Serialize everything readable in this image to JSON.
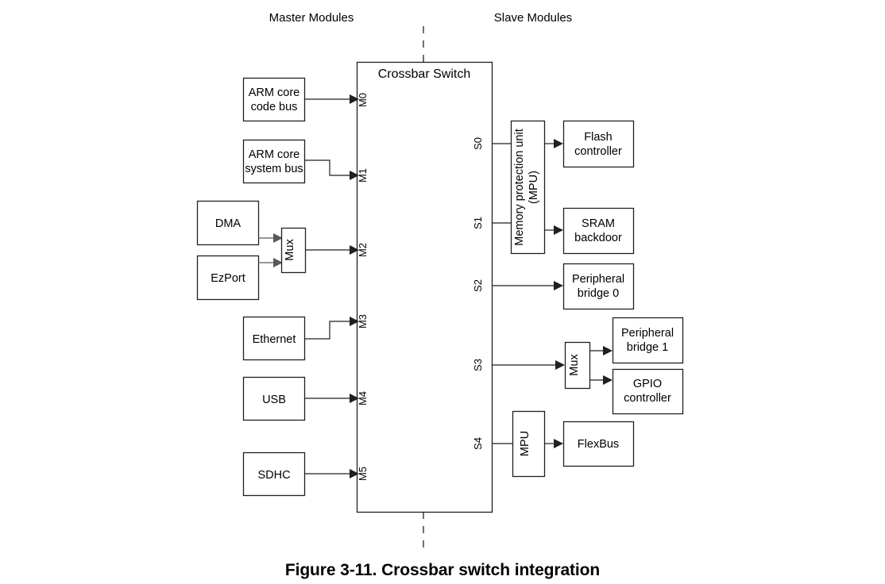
{
  "figure": {
    "caption": "Figure 3-11. Crossbar switch integration",
    "headings": {
      "master": "Master Modules",
      "slave": "Slave Modules"
    },
    "switch": {
      "title": "Crossbar Switch"
    }
  },
  "master_ports": [
    {
      "id": "M0",
      "label": "M0"
    },
    {
      "id": "M1",
      "label": "M1"
    },
    {
      "id": "M2",
      "label": "M2"
    },
    {
      "id": "M3",
      "label": "M3"
    },
    {
      "id": "M4",
      "label": "M4"
    },
    {
      "id": "M5",
      "label": "M5"
    }
  ],
  "slave_ports": [
    {
      "id": "S0",
      "label": "S0"
    },
    {
      "id": "S1",
      "label": "S1"
    },
    {
      "id": "S2",
      "label": "S2"
    },
    {
      "id": "S3",
      "label": "S3"
    },
    {
      "id": "S4",
      "label": "S4"
    }
  ],
  "master_modules": [
    {
      "id": "arm-code-bus",
      "line1": "ARM core",
      "line2": "code bus",
      "port": "M0"
    },
    {
      "id": "arm-system-bus",
      "line1": "ARM core",
      "line2": "system bus",
      "port": "M1"
    },
    {
      "id": "dma",
      "line1": "DMA",
      "line2": "",
      "port": "M2"
    },
    {
      "id": "ezport",
      "line1": "EzPort",
      "line2": "",
      "port": "M2"
    },
    {
      "id": "ethernet",
      "line1": "Ethernet",
      "line2": "",
      "port": "M3"
    },
    {
      "id": "usb",
      "line1": "USB",
      "line2": "",
      "port": "M4"
    },
    {
      "id": "sdhc",
      "line1": "SDHC",
      "line2": "",
      "port": "M5"
    }
  ],
  "master_mux": {
    "id": "master-mux",
    "label": "Mux",
    "inputs": [
      "DMA",
      "EzPort"
    ],
    "output_port": "M2"
  },
  "slave_modules": [
    {
      "id": "flash-controller",
      "line1": "Flash",
      "line2": "controller",
      "port": "S0"
    },
    {
      "id": "sram-backdoor",
      "line1": "SRAM",
      "line2": "backdoor",
      "port": "S1"
    },
    {
      "id": "peripheral-bridge-0",
      "line1": "Peripheral",
      "line2": "bridge 0",
      "port": "S2"
    },
    {
      "id": "peripheral-bridge-1",
      "line1": "Peripheral",
      "line2": "bridge 1",
      "port": "S3"
    },
    {
      "id": "gpio-controller",
      "line1": "GPIO",
      "line2": "controller",
      "port": "S3"
    },
    {
      "id": "flexbus",
      "line1": "FlexBus",
      "line2": "",
      "port": "S4"
    }
  ],
  "memory_protection_unit": {
    "id": "mpu-shared",
    "line1": "Memory protection unit",
    "line2": "(MPU)",
    "ports": [
      "S0",
      "S1"
    ]
  },
  "flexbus_mpu": {
    "id": "mpu-flexbus",
    "label": "MPU",
    "port": "S4"
  },
  "slave_mux": {
    "id": "slave-mux",
    "label": "Mux",
    "input_port": "S3",
    "outputs": [
      "Peripheral bridge 1",
      "GPIO controller"
    ]
  },
  "colors": {
    "stroke": "#231f20",
    "thin_stroke": "#58595b",
    "fill": "#ffffff",
    "text": "#000000"
  }
}
